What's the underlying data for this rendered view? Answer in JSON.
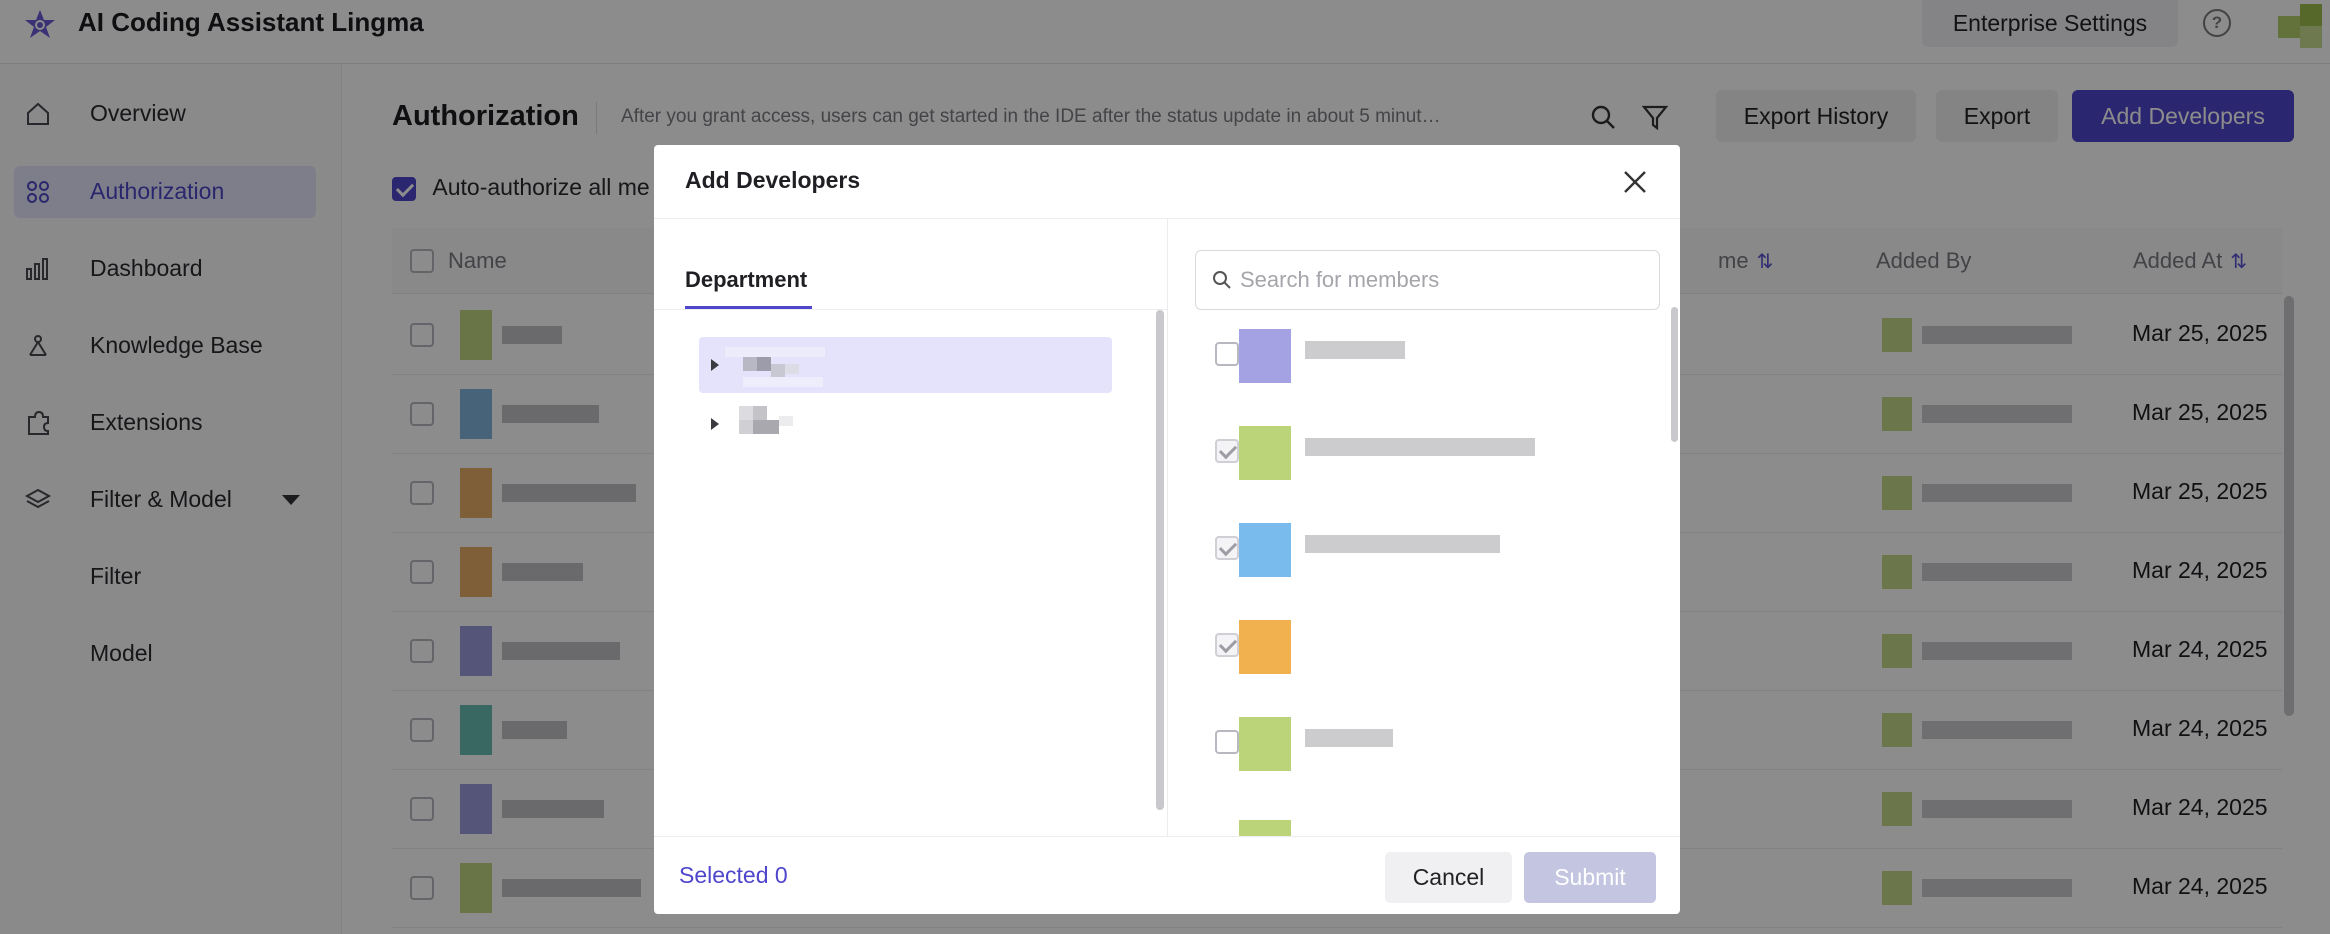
{
  "app": {
    "title": "AI Coding Assistant Lingma"
  },
  "topbar": {
    "enterprise_settings": "Enterprise Settings",
    "help_icon": "question-circle-icon"
  },
  "sidebar": {
    "items": [
      {
        "label": "Overview",
        "icon": "home-icon"
      },
      {
        "label": "Authorization",
        "icon": "grid-icon",
        "active": true
      },
      {
        "label": "Dashboard",
        "icon": "bar-chart-icon"
      },
      {
        "label": "Knowledge Base",
        "icon": "knowledge-icon"
      },
      {
        "label": "Extensions",
        "icon": "puzzle-icon"
      },
      {
        "label": "Filter & Model",
        "icon": "layers-icon",
        "expanded": true
      },
      {
        "label": "Filter"
      },
      {
        "label": "Model"
      }
    ]
  },
  "main": {
    "title": "Authorization",
    "description": "After you grant access, users can get started in the IDE after the status update in about 5 minutes.",
    "export_history": "Export History",
    "export": "Export",
    "add_developers": "Add Developers",
    "auto_authorize": "Auto-authorize all me",
    "columns": {
      "name": "Name",
      "partial_col": "me",
      "added_by": "Added By",
      "added_at": "Added At"
    },
    "rows": [
      {
        "date": "Mar 25, 2025"
      },
      {
        "date": "Mar 25, 2025"
      },
      {
        "date": "Mar 25, 2025"
      },
      {
        "date": "Mar 24, 2025"
      },
      {
        "date": "Mar 24, 2025"
      },
      {
        "date": "Mar 24, 2025"
      },
      {
        "date": "Mar 24, 2025"
      },
      {
        "date": "Mar 24, 2025"
      }
    ]
  },
  "modal": {
    "title": "Add Developers",
    "department_tab": "Department",
    "search_placeholder": "Search for members",
    "selected_label": "Selected 0",
    "cancel": "Cancel",
    "submit": "Submit",
    "members": [
      {
        "checked": false
      },
      {
        "checked": true
      },
      {
        "checked": true
      },
      {
        "checked": true
      },
      {
        "checked": false
      }
    ]
  },
  "colors": {
    "accent": "#4f46cc",
    "active_bg": "#e6e6fb",
    "submit_disabled": "#c4c5e1"
  }
}
